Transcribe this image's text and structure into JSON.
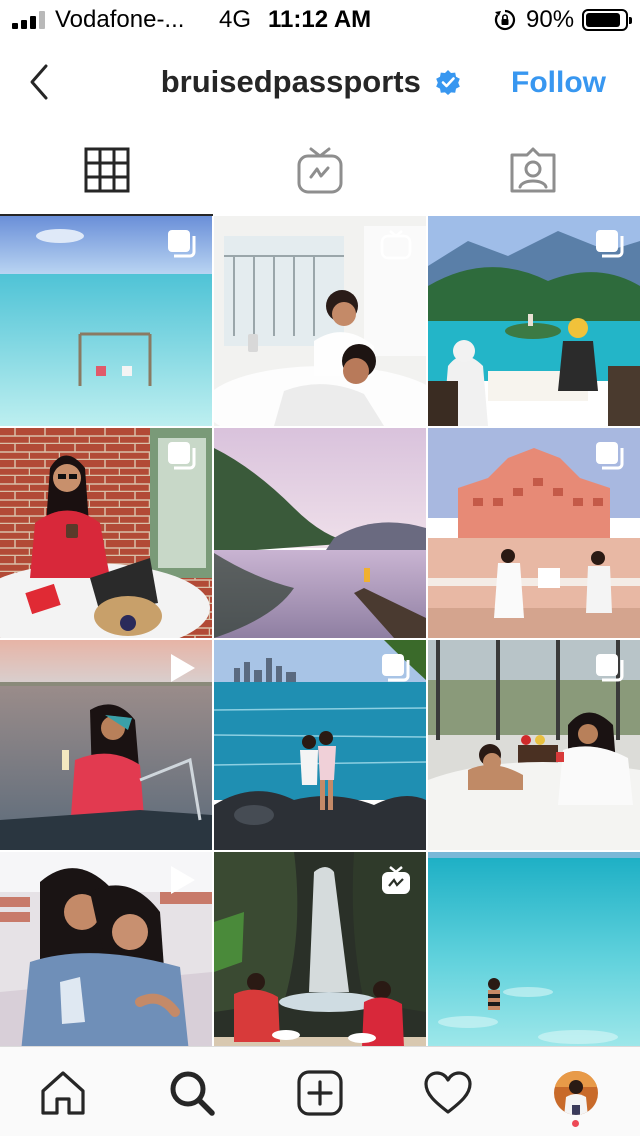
{
  "status_bar": {
    "carrier": "Vodafone-...",
    "network": "4G",
    "time": "11:12 AM",
    "battery": "90%",
    "battery_level": 0.9
  },
  "header": {
    "username": "bruisedpassports",
    "verified": true,
    "follow_label": "Follow",
    "accent_color": "#3897f0",
    "verified_color": "#3897f0"
  },
  "tabs": [
    {
      "icon": "grid-icon",
      "active": true
    },
    {
      "icon": "igtv-icon",
      "active": false
    },
    {
      "icon": "tagged-icon",
      "active": false
    }
  ],
  "posts": [
    {
      "scene": "maldives lagoon with swing",
      "badge": "carousel"
    },
    {
      "scene": "couple lounging in bed with phone",
      "badge": "igtv"
    },
    {
      "scene": "lake bled breakfast view",
      "badge": "carousel"
    },
    {
      "scene": "woman with laptop at brick wall",
      "badge": "carousel"
    },
    {
      "scene": "misty mountain lake with dock",
      "badge": "none"
    },
    {
      "scene": "hawa mahal jaipur couple",
      "badge": "carousel"
    },
    {
      "scene": "woman on boat at sunset",
      "badge": "video"
    },
    {
      "scene": "couple on rocks by the sea",
      "badge": "carousel"
    },
    {
      "scene": "couple in bed with lake view",
      "badge": "carousel"
    },
    {
      "scene": "two women hugging at airport",
      "badge": "video"
    },
    {
      "scene": "couple dining by waterfall",
      "badge": "igtv"
    },
    {
      "scene": "woman in turquoise sea",
      "badge": "none"
    }
  ],
  "bottom_nav": [
    {
      "icon": "home-icon"
    },
    {
      "icon": "search-icon"
    },
    {
      "icon": "new-post-icon"
    },
    {
      "icon": "activity-heart-icon"
    },
    {
      "icon": "profile-avatar"
    }
  ],
  "notification_dot_color": "#ed4956"
}
